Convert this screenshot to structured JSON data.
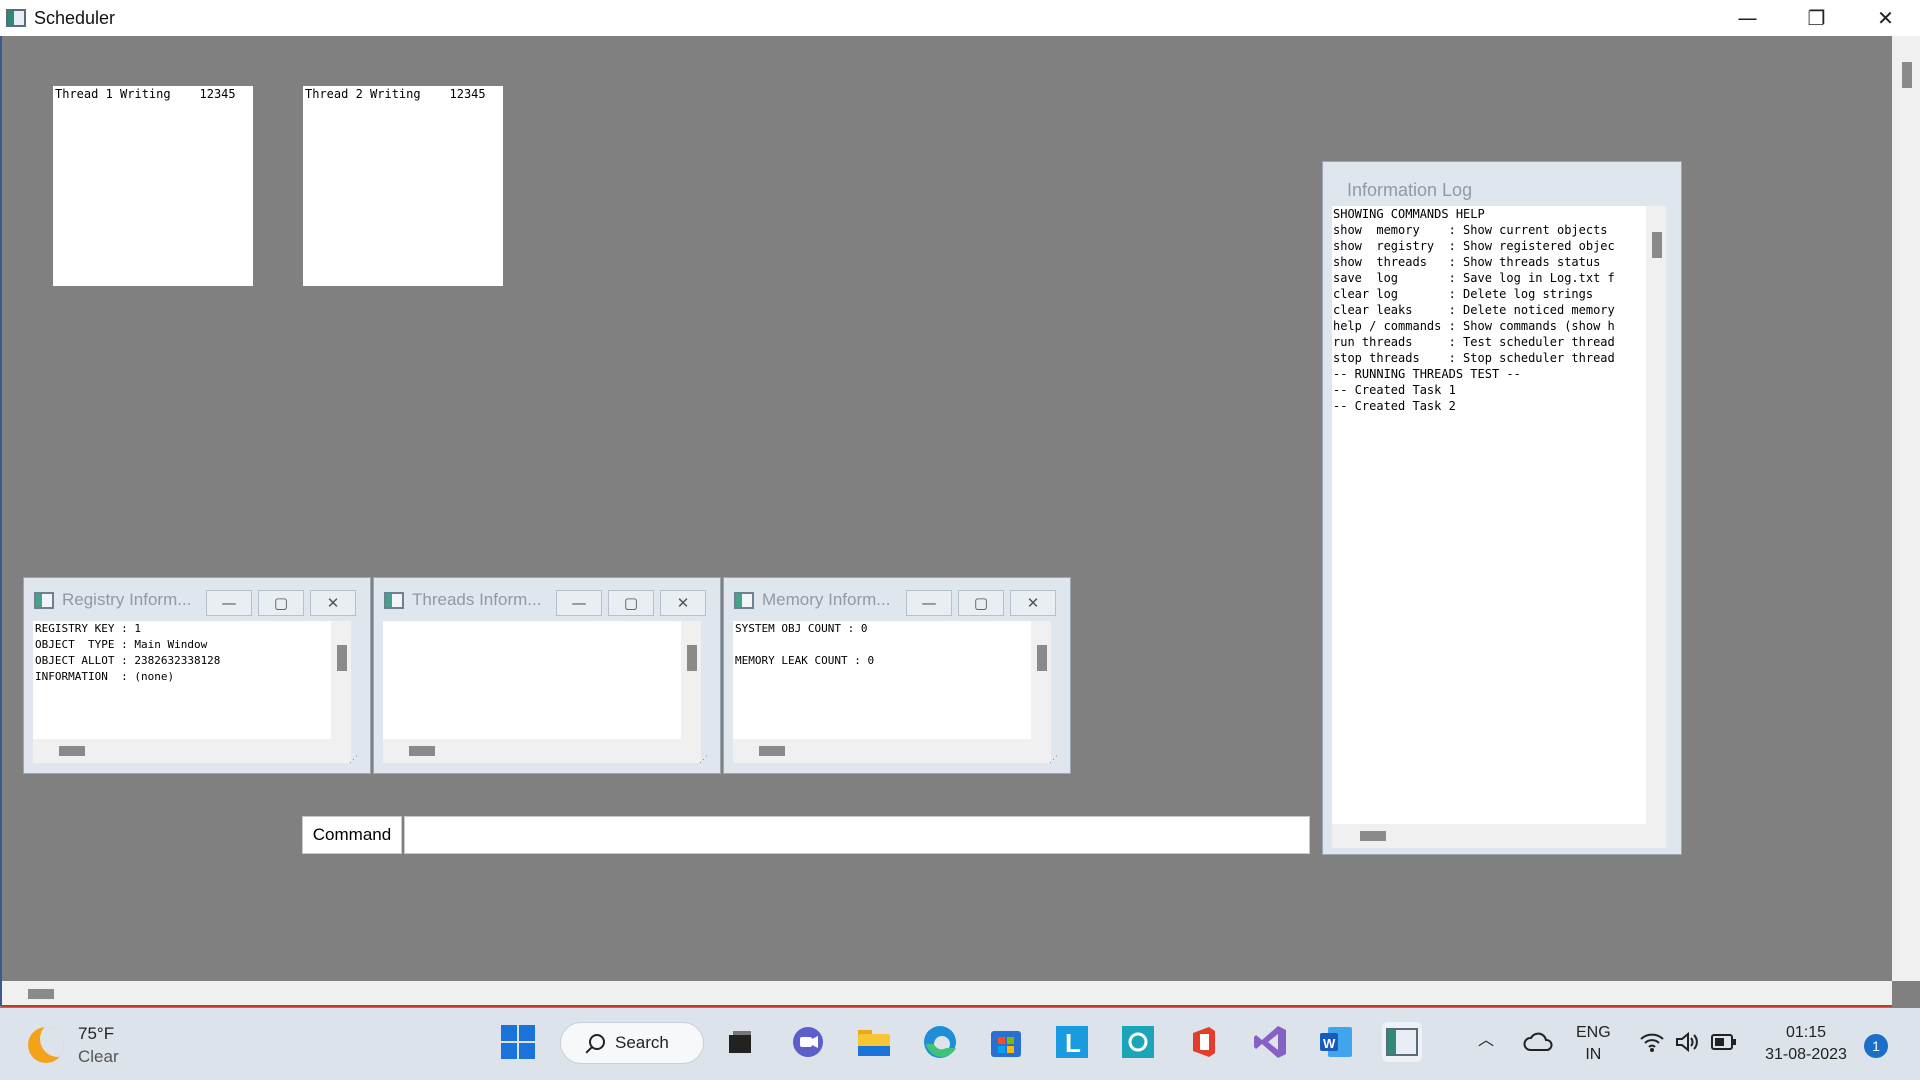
{
  "window": {
    "title": "Scheduler",
    "minimize_glyph": "—",
    "restore_glyph": "❐",
    "close_glyph": "✕"
  },
  "threads": [
    {
      "text": "Thread 1 Writing    12345"
    },
    {
      "text": "Thread 2 Writing    12345"
    }
  ],
  "child_windows": {
    "registry": {
      "title": "Registry Inform...",
      "lines": "REGISTRY KEY : 1\nOBJECT  TYPE : Main Window\nOBJECT ALLOT : 2382632338128\nINFORMATION  : (none)"
    },
    "threads": {
      "title": "Threads Inform...",
      "lines": ""
    },
    "memory": {
      "title": "Memory Inform...",
      "lines": "SYSTEM OBJ COUNT : 0\n\nMEMORY LEAK COUNT : 0"
    },
    "btn_minimize": "—",
    "btn_maximize": "▢",
    "btn_close": "✕"
  },
  "info_log": {
    "title": "Information  Log",
    "lines": "SHOWING COMMANDS HELP\nshow  memory    : Show current objects\nshow  registry  : Show registered objec\nshow  threads   : Show threads status\nsave  log       : Save log in Log.txt f\nclear log       : Delete log strings\nclear leaks     : Delete noticed memory\nhelp / commands : Show commands (show h\nrun threads     : Test scheduler thread\nstop threads    : Stop scheduler thread\n-- RUNNING THREADS TEST --\n-- Created Task 1\n-- Created Task 2"
  },
  "command": {
    "label": "Command",
    "value": ""
  },
  "taskbar": {
    "weather_temp": "75°F",
    "weather_cond": "Clear",
    "search_label": "Search",
    "lang_top": "ENG",
    "lang_bottom": "IN",
    "time": "01:15",
    "date": "31-08-2023",
    "notification_count": "1"
  },
  "colors": {
    "client_bg": "#808080",
    "taskbar_bg": "#dde3ea",
    "accent": "#1a73d9"
  }
}
